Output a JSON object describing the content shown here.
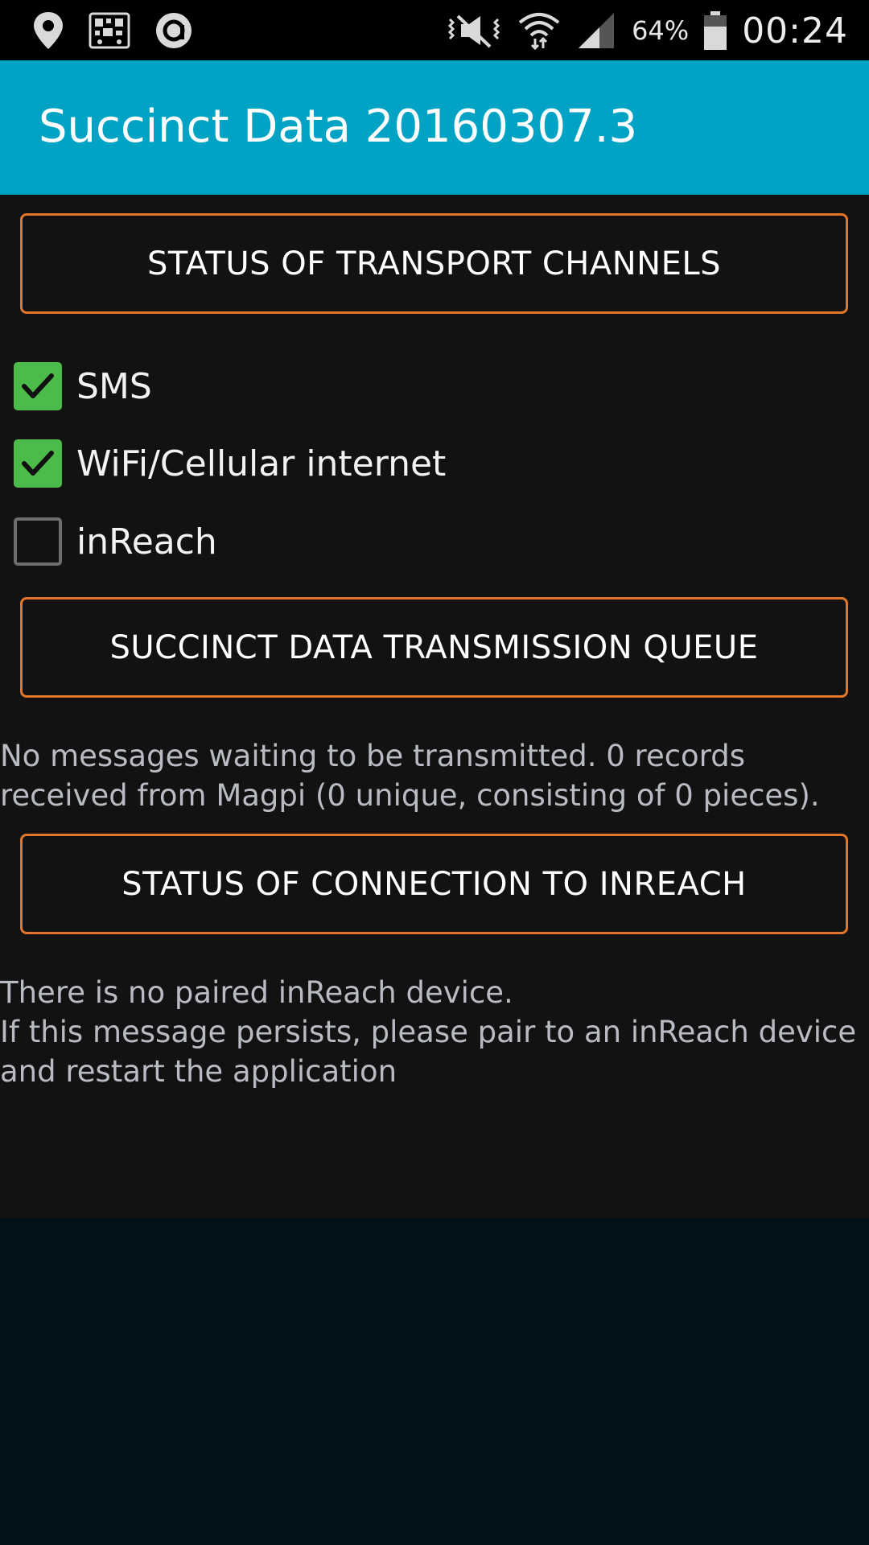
{
  "status_bar": {
    "battery_percent": "64%",
    "clock": "00:24",
    "icons": [
      "location-icon",
      "qr-notification-icon",
      "app-notification-icon",
      "mute-vibrate-icon",
      "wifi-icon",
      "cell-signal-icon",
      "battery-icon"
    ]
  },
  "app_bar": {
    "title": "Succinct Data 20160307.3"
  },
  "sections": {
    "transport_status_label": "STATUS OF TRANSPORT CHANNELS",
    "queue_label": "SUCCINCT DATA TRANSMISSION QUEUE",
    "inreach_status_label": "STATUS OF CONNECTION TO INREACH"
  },
  "channels": [
    {
      "label": "SMS",
      "checked": true
    },
    {
      "label": "WiFi/Cellular internet",
      "checked": true
    },
    {
      "label": "inReach",
      "checked": false
    }
  ],
  "queue_message": {
    "line1": "No messages waiting to be transmitted.  0 records",
    "line2": "received from Magpi (0 unique, consisting of 0 pieces)."
  },
  "inreach_message": {
    "line1": "There is no paired inReach device.",
    "line2": "If this message persists, please pair to an inReach device",
    "line3": "and restart the application"
  },
  "colors": {
    "accent": "#00a3c4",
    "button_border": "#e2772a",
    "checkbox_checked": "#4cbb49",
    "content_bg": "#121212",
    "screen_bg": "#03111a"
  }
}
